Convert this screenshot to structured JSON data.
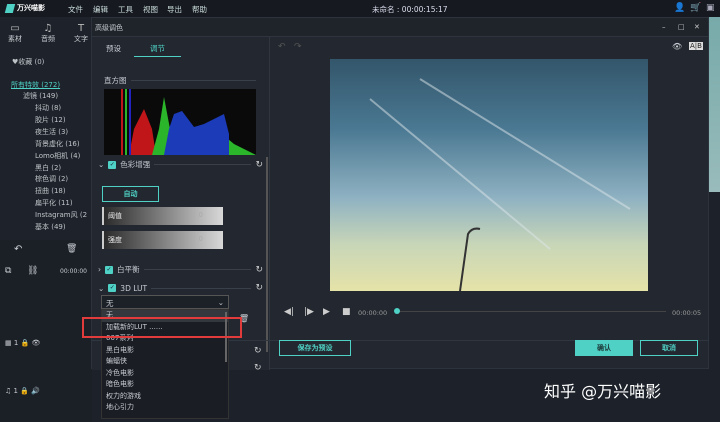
{
  "app": {
    "name": "万兴喵影",
    "menu": [
      "文件",
      "编辑",
      "工具",
      "视图",
      "导出",
      "帮助"
    ],
    "project_title": "未命名 : 00:00:15:17"
  },
  "toolbar": {
    "items": [
      "素材",
      "音频",
      "文字"
    ]
  },
  "library": {
    "favorites": "♥收藏 (0)",
    "all": "所有特效 (272)",
    "filter": "滤镜 (149)",
    "items": [
      "抖动 (8)",
      "胶片 (12)",
      "夜生活 (3)",
      "背景虚化 (16)",
      "Lomo相机 (4)",
      "黑白 (2)",
      "棕色调 (2)",
      "扭曲 (18)",
      "扁平化 (11)",
      "Instagram风 (2",
      "基本 (49)"
    ]
  },
  "timeline": {
    "time": "00:00:00",
    "video_track": "1",
    "audio_track": "1"
  },
  "dialog": {
    "title": "高级调色",
    "tabs": [
      "预设",
      "调节"
    ],
    "active_tab": "调节",
    "histogram_label": "直方图",
    "color_enhance": "色彩增强",
    "auto_button": "自动",
    "sliders": [
      {
        "label": "阈值",
        "value": "0"
      },
      {
        "label": "强度",
        "value": "0"
      }
    ],
    "white_balance": "白平衡",
    "lut": "3D LUT",
    "lut_selected": "无",
    "lut_options": [
      "无",
      "加载新的LUT ......",
      "007系列",
      "黑白电影",
      "蝙蝠侠",
      "冷色电影",
      "暗色电影",
      "权力的游戏",
      "地心引力"
    ],
    "time_start": "00:00:00",
    "time_end": "00:00:05",
    "save_preset": "保存为预设",
    "confirm": "确认",
    "cancel": "取消"
  },
  "watermark": "知乎 @万兴喵影",
  "colors": {
    "accent": "#4fd1c5",
    "highlight": "#e23b3b"
  }
}
